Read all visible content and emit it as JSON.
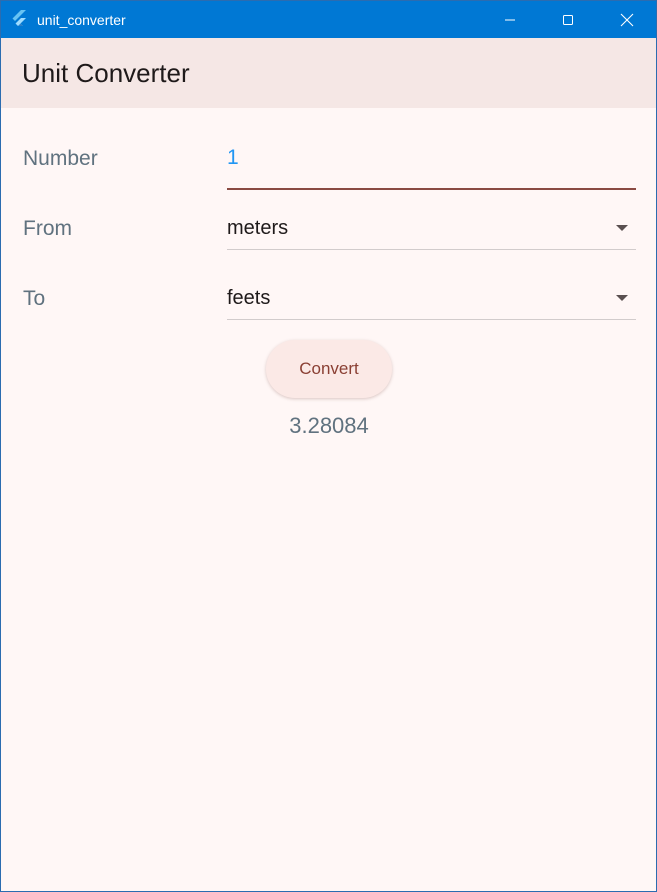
{
  "window": {
    "title": "unit_converter",
    "titlebar_color": "#0078d4"
  },
  "appbar": {
    "title": "Unit Converter",
    "background": "#f5e7e5"
  },
  "form": {
    "number_label": "Number",
    "number_value": "1",
    "from_label": "From",
    "from_value": "meters",
    "to_label": "To",
    "to_value": "feets"
  },
  "actions": {
    "convert_label": "Convert"
  },
  "result": {
    "value": "3.28084"
  },
  "icons": {
    "app": "flutter-icon",
    "minimize": "minimize-icon",
    "maximize": "maximize-icon",
    "close": "close-icon",
    "dropdown": "dropdown-arrow-icon"
  },
  "colors": {
    "accent": "#2196f3",
    "underline_focused": "#8a4a42",
    "label": "#60727f",
    "button_text": "#8a3f33"
  }
}
